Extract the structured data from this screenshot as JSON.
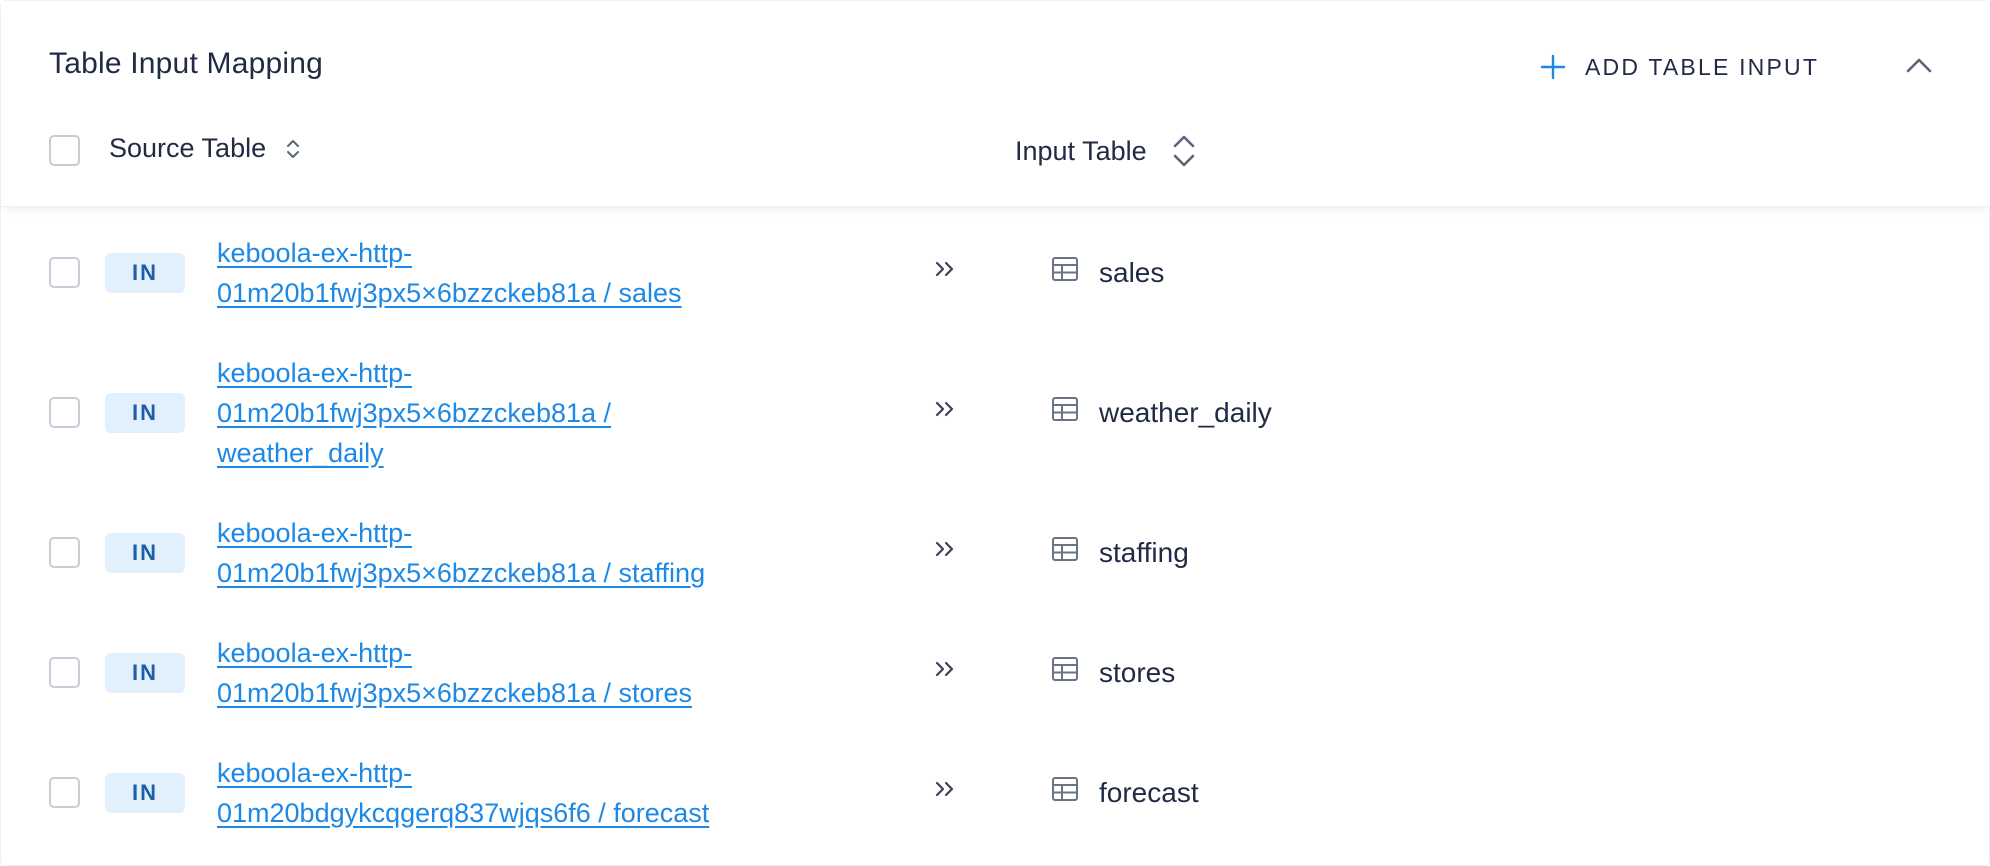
{
  "panel": {
    "title": "Table Input Mapping",
    "add_button_label": "ADD TABLE INPUT",
    "icons": {
      "add": "plus-icon",
      "collapse": "chevron-up-icon",
      "sort": "sort-icon",
      "mapping": "double-chevron-right-icon",
      "table": "table-grid-icon"
    },
    "colors": {
      "accent": "#1e88e5",
      "badge_bg": "#e2effd",
      "badge_text": "#1f5fa6",
      "text": "#222b45"
    }
  },
  "columns": {
    "source": "Source Table",
    "input": "Input Table"
  },
  "rows": [
    {
      "badge": "IN",
      "source_line1": "keboola-ex-http-",
      "source_line2": "01m20b1fwj3px5×6bzzckeb81a / sales",
      "source_line3": "",
      "input_table": "sales"
    },
    {
      "badge": "IN",
      "source_line1": "keboola-ex-http-",
      "source_line2": "01m20b1fwj3px5×6bzzckeb81a /",
      "source_line3": "weather_daily",
      "input_table": "weather_daily"
    },
    {
      "badge": "IN",
      "source_line1": "keboola-ex-http-",
      "source_line2": "01m20b1fwj3px5×6bzzckeb81a / staffing",
      "source_line3": "",
      "input_table": "staffing"
    },
    {
      "badge": "IN",
      "source_line1": "keboola-ex-http-",
      "source_line2": "01m20b1fwj3px5×6bzzckeb81a / stores",
      "source_line3": "",
      "input_table": "stores"
    },
    {
      "badge": "IN",
      "source_line1": "keboola-ex-http-",
      "source_line2": "01m20bdgykcqgerq837wjqs6f6 / forecast",
      "source_line3": "",
      "input_table": "forecast"
    }
  ]
}
